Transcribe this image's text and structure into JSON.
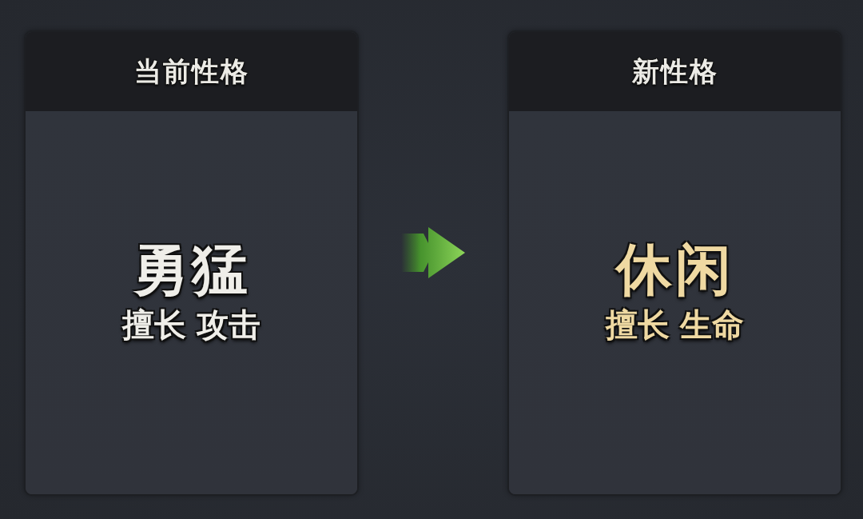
{
  "panels": [
    {
      "kind": "current",
      "title": "当前性格",
      "trait": "勇猛",
      "specialty": "擅长 攻击"
    },
    {
      "kind": "new",
      "title": "新性格",
      "trait": "休闲",
      "specialty": "擅长 生命"
    }
  ]
}
